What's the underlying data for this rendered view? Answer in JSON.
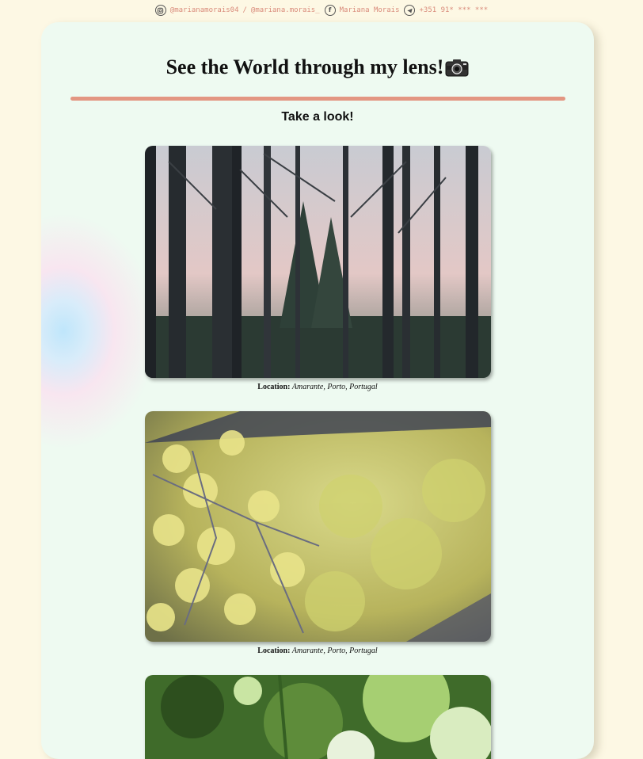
{
  "topbar": {
    "instagram_handle": "@marianamorais04",
    "separator": "/",
    "alt_handle": "@mariana.morais_",
    "facebook_name": "Mariana Morais",
    "phone": "+351 91* *** ***"
  },
  "page": {
    "title": "See the World through my lens!",
    "subtitle": "Take a look!"
  },
  "gallery": [
    {
      "location_label": "Location:",
      "location": "Amarante, Porto, Portugal"
    },
    {
      "location_label": "Location:",
      "location": "Amarante, Porto, Portugal"
    }
  ],
  "colors": {
    "background": "#fdf8e4",
    "card": "#eefaf1",
    "accent_rule": "#e39682",
    "contact_text": "#d98a7a"
  },
  "icons": [
    "instagram-icon",
    "facebook-icon",
    "telegram-icon",
    "camera-icon"
  ]
}
